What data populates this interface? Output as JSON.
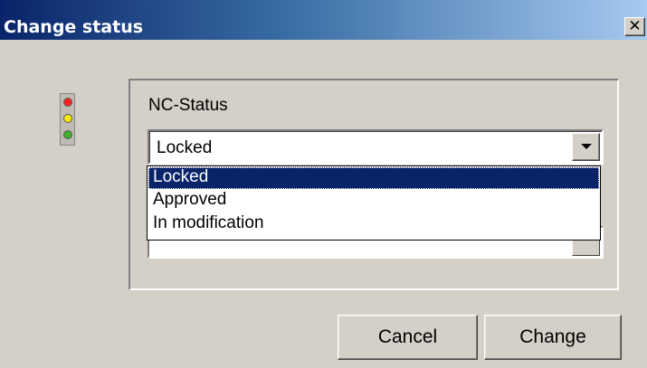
{
  "window": {
    "title": "Change status",
    "close_glyph": "✕"
  },
  "status_indicator": {
    "icon": "traffic-light-icon",
    "colors": {
      "red": "#ff2020",
      "yellow": "#ffe800",
      "green": "#40b030"
    }
  },
  "field": {
    "label": "NC-Status",
    "selected_value": "Locked"
  },
  "dropdown": {
    "options": [
      "Locked",
      "Approved",
      "In modification"
    ],
    "highlighted_index": 0
  },
  "buttons": {
    "cancel_label": "Cancel",
    "change_label": "Change"
  },
  "colors": {
    "dialog_bg": "#d4d0c8",
    "titlebar_start": "#0a246a",
    "titlebar_end": "#a6caf0",
    "selection": "#0a246a"
  }
}
